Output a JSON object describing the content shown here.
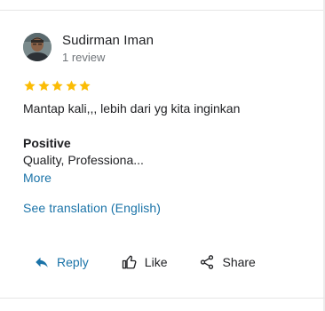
{
  "review": {
    "author_name": "Sudirman Iman",
    "author_meta": "1 review",
    "rating": 5,
    "text": "Mantap kali,,, lebih dari yg kita inginkan",
    "attribute_label": "Positive",
    "attribute_value": "Quality, Professiona...",
    "more_label": "More",
    "translate_label": "See translation (English)"
  },
  "actions": {
    "reply_label": "Reply",
    "like_label": "Like",
    "share_label": "Share"
  },
  "colors": {
    "star": "#fbbc04",
    "link": "#1a73a8",
    "text": "#202124",
    "meta": "#70757a"
  },
  "icons": {
    "reply": "reply-arrow-icon",
    "like": "thumbs-up-icon",
    "share": "share-icon",
    "star": "star-icon"
  }
}
